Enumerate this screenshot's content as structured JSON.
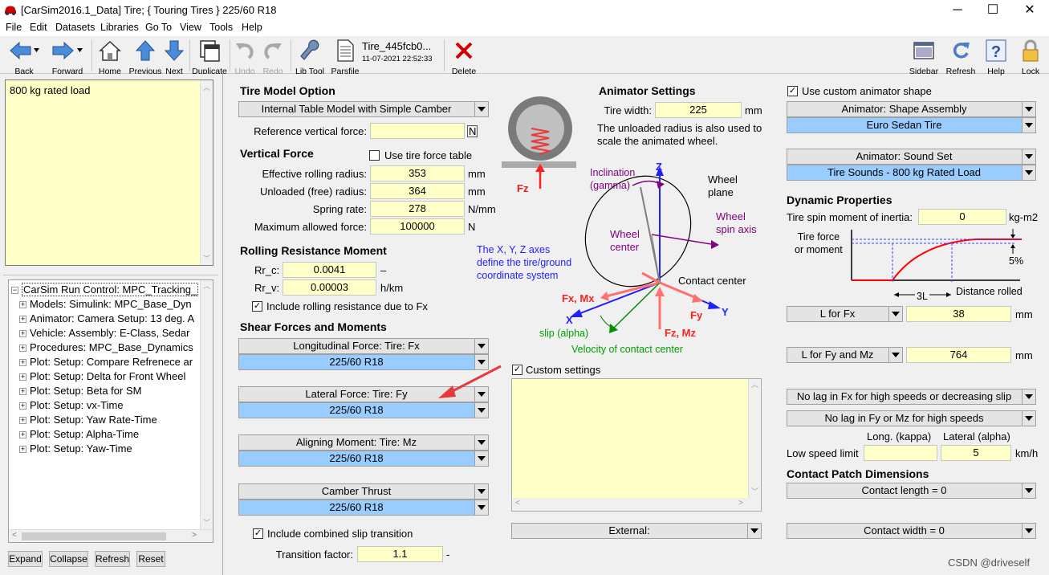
{
  "window": {
    "title": "[CarSim2016.1_Data] Tire; { Touring Tires } 225/60 R18",
    "minimize": "─",
    "maximize": "☐",
    "close": "✕"
  },
  "menu": [
    "File",
    "Edit",
    "Datasets",
    "Libraries",
    "Go To",
    "View",
    "Tools",
    "Help"
  ],
  "toolbar": {
    "back": "Back",
    "forward": "Forward",
    "home": "Home",
    "previous": "Previous",
    "next": "Next",
    "duplicate": "Duplicate",
    "undo": "Undo",
    "redo": "Redo",
    "lib_tool": "Lib Tool",
    "parsfile": "Parsfile",
    "dataset_name": "Tire_445fcb0...",
    "dataset_time": "11-07-2021 22:52:33",
    "delete": "Delete",
    "sidebar": "Sidebar",
    "refresh": "Refresh",
    "help": "Help",
    "lock": "Lock"
  },
  "notes": "800 kg rated load",
  "tree": {
    "root": "CarSim Run Control: MPC_Tracking_",
    "items": [
      "Models: Simulink: MPC_Base_Dyn",
      "Animator: Camera Setup: 13 deg. A",
      "Vehicle: Assembly: E-Class, Sedar",
      "Procedures: MPC_Base_Dynamics",
      "Plot: Setup: Compare Refrenece ar",
      "Plot: Setup: Delta for Front Wheel",
      "Plot: Setup: Beta for SM",
      "Plot: Setup: vx-Time",
      "Plot: Setup: Yaw Rate-Time",
      "Plot: Setup: Alpha-Time",
      "Plot: Setup: Yaw-Time"
    ]
  },
  "left_buttons": {
    "expand": "Expand",
    "collapse": "Collapse",
    "refresh": "Refresh",
    "reset": "Reset"
  },
  "tire_model": {
    "header": "Tire Model Option",
    "option": "Internal Table Model with Simple Camber",
    "ref_force_label": "Reference vertical force:",
    "ref_force_value": "",
    "ref_force_unit": "N"
  },
  "vertical_force": {
    "header": "Vertical Force",
    "use_table_label": "Use tire force table",
    "use_table_checked": false,
    "rows": [
      {
        "label": "Effective rolling radius:",
        "value": "353",
        "unit": "mm"
      },
      {
        "label": "Unloaded (free) radius:",
        "value": "364",
        "unit": "mm"
      },
      {
        "label": "Spring rate:",
        "value": "278",
        "unit": "N/mm"
      },
      {
        "label": "Maximum allowed force:",
        "value": "100000",
        "unit": "N"
      }
    ]
  },
  "rolling_resistance": {
    "header": "Rolling Resistance Moment",
    "rows": [
      {
        "label": "Rr_c:",
        "value": "0.0041",
        "unit": "–"
      },
      {
        "label": "Rr_v:",
        "value": "0.00003",
        "unit": "h/km"
      }
    ],
    "include_label": "Include rolling resistance due to Fx",
    "include_checked": true
  },
  "shear": {
    "header": "Shear Forces and Moments",
    "groups": [
      {
        "name": "Longitudinal Force: Tire: Fx",
        "value": "225/60 R18"
      },
      {
        "name": "Lateral Force: Tire: Fy",
        "value": "225/60 R18"
      },
      {
        "name": "Aligning Moment: Tire: Mz",
        "value": "225/60 R18"
      },
      {
        "name": "Camber Thrust",
        "value": "225/60 R18"
      }
    ],
    "combined_label": "Include combined slip transition",
    "combined_checked": true,
    "transition_label": "Transition factor:",
    "transition_value": "1.1",
    "transition_unit": "-"
  },
  "animator_settings": {
    "header": "Animator Settings",
    "tire_width_label": "Tire width:",
    "tire_width_value": "225",
    "tire_width_unit": "mm",
    "note_line1": "The unloaded radius is also used to",
    "note_line2": "scale the animated wheel."
  },
  "diagram": {
    "fz_small": "Fz",
    "inclination1": "Inclination",
    "inclination2": "(gamma)",
    "z": "Z",
    "wheel_plane1": "Wheel",
    "wheel_plane2": "plane",
    "wheel_spin1": "Wheel",
    "wheel_spin2": "spin axis",
    "wheel_center1": "Wheel",
    "wheel_center2": "center",
    "axes_note1": "The X, Y, Z axes",
    "axes_note2": "define the tire/ground",
    "axes_note3": "coordinate system",
    "contact_center": "Contact center",
    "fx_mx": "Fx, Mx",
    "fy": "Fy",
    "x": "X",
    "y": "Y",
    "fz_mz": "Fz, Mz",
    "slip": "slip (alpha)",
    "velocity": "Velocity of contact center"
  },
  "custom_settings": {
    "label": "Custom settings",
    "checked": true,
    "text": ""
  },
  "external": {
    "value": "External:"
  },
  "custom_animator": {
    "label": "Use custom animator shape",
    "checked": true,
    "shape_name": "Animator: Shape Assembly",
    "shape_value": "Euro Sedan Tire",
    "sound_name": "Animator: Sound Set",
    "sound_value": "Tire Sounds - 800 kg Rated Load"
  },
  "dynamic": {
    "header": "Dynamic Properties",
    "inertia_label": "Tire spin moment of inertia:",
    "inertia_value": "0",
    "inertia_unit": "kg-m2",
    "graph_ylabel1": "Tire force",
    "graph_ylabel2": "or moment",
    "graph_3l": "3L",
    "graph_xlabel": "Distance rolled",
    "graph_5pct": "5%",
    "lfx_label": "L for Fx",
    "lfx_value": "38",
    "lfx_unit": "mm",
    "lfy_label": "L for Fy and Mz",
    "lfy_value": "764",
    "lfy_unit": "mm",
    "lag_fx": "No lag in Fx for high speeds or decreasing slip",
    "lag_fy": "No lag in Fy or Mz for high speeds",
    "long_label": "Long. (kappa)",
    "lat_label": "Lateral (alpha)",
    "low_speed_label": "Low speed limit",
    "low_speed_long": "",
    "low_speed_lat": "5",
    "low_speed_unit": "km/h"
  },
  "contact_patch": {
    "header": "Contact Patch Dimensions",
    "length": "Contact length = 0",
    "width": "Contact width = 0"
  },
  "watermark": "CSDN @driveself",
  "colors": {
    "field_yellow": "#ffffc8",
    "dropdown_blue": "#99ccff",
    "force_red": "#ff4040",
    "axis_blue": "#1f1fff",
    "purple": "#800080",
    "green": "#00a000"
  }
}
